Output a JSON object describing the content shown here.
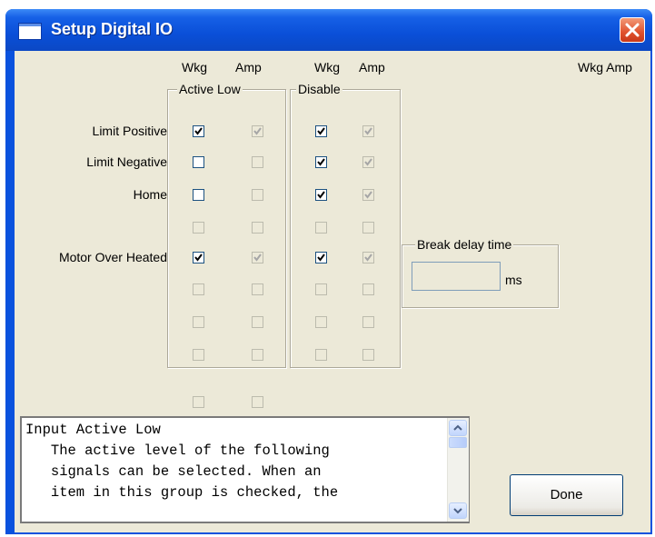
{
  "window": {
    "title": "Setup Digital IO",
    "close_glyph": "×"
  },
  "headers": {
    "active_low_wkg": "Wkg",
    "active_low_amp": "Amp",
    "disable_wkg": "Wkg",
    "disable_amp": "Amp",
    "right_wkg_amp": "Wkg Amp"
  },
  "groups": {
    "active_low": "Active Low",
    "disable": "Disable",
    "break_delay": "Break delay time"
  },
  "rows": [
    {
      "label": "Limit Positive",
      "al_wkg": true,
      "al_amp": true,
      "al_amp_enabled": false,
      "dis_wkg": true,
      "dis_amp": true
    },
    {
      "label": "Limit Negative",
      "al_wkg": false,
      "al_amp": false,
      "al_amp_enabled": false,
      "dis_wkg": true,
      "dis_amp": true
    },
    {
      "label": "Home",
      "al_wkg": false,
      "al_amp": false,
      "al_amp_enabled": false,
      "dis_wkg": true,
      "dis_amp": true
    },
    {
      "label": "",
      "al_wkg": false,
      "al_amp": false,
      "al_amp_enabled": false,
      "dis_wkg": false,
      "dis_amp": false
    },
    {
      "label": "Motor Over Heated",
      "al_wkg": true,
      "al_amp": true,
      "al_amp_enabled": false,
      "dis_wkg": true,
      "dis_amp": true
    },
    {
      "label": "",
      "al_wkg": false,
      "al_amp": false,
      "al_amp_enabled": false,
      "dis_wkg": false,
      "dis_amp": false
    },
    {
      "label": "",
      "al_wkg": false,
      "al_amp": false,
      "al_amp_enabled": false,
      "dis_wkg": false,
      "dis_amp": false
    },
    {
      "label": "",
      "al_wkg": false,
      "al_amp": false,
      "al_amp_enabled": false,
      "dis_wkg": false,
      "dis_amp": false
    }
  ],
  "break_delay": {
    "value": "",
    "unit": "ms"
  },
  "help_text": "Input Active Low\n   The active level of the following\n   signals can be selected. When an\n   item in this group is checked, the",
  "done_label": "Done",
  "icons": {
    "scroll_up": "scroll-up-arrow",
    "scroll_down": "scroll-down-arrow",
    "check": "check-mark"
  }
}
